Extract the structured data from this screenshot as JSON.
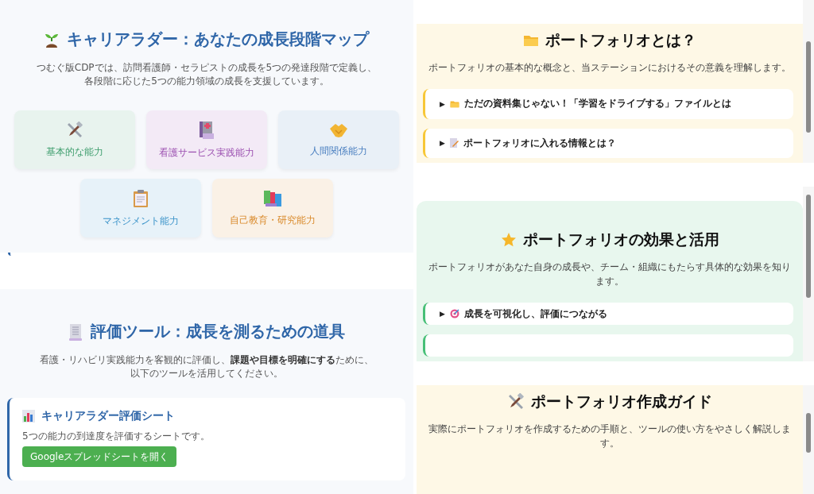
{
  "career_ladder": {
    "title": "キャリアラダー：あなたの成長段階マップ",
    "description": [
      "つむぐ版CDPでは、訪問看護師・セラピストの成長を5つの発達段階で定義し、",
      "各段階に応じた5つの能力領域の成長を支援しています。"
    ],
    "abilities": [
      {
        "label": "基本的な能力",
        "color": "#3f9e6e"
      },
      {
        "label": "看護サービス実践能力",
        "color": "#9b4fb0"
      },
      {
        "label": "人間関係能力",
        "color": "#4a7fc0"
      },
      {
        "label": "マネジメント能力",
        "color": "#3a93c9"
      },
      {
        "label": "自己教育・研究能力",
        "color": "#d98a2b"
      }
    ]
  },
  "evaluation_tools": {
    "title": "評価ツール：成長を測るための道具",
    "description": [
      "看護・リハビリ実践能力を客観的に評価し、**課題や目標を明確にする**ために、",
      "以下のツールを活用してください。"
    ],
    "tools": [
      {
        "title": "キャリアラダー評価シート",
        "description": "5つの能力の到達度を評価するシートです。",
        "button": "Googleスプレッドシートを開く"
      }
    ]
  },
  "portfolio_panels": [
    {
      "title": "ポートフォリオとは？",
      "description": "ポートフォリオの基本的な概念と、当ステーションにおけるその意義を理解します。",
      "color": "#fef8e6",
      "accordions": [
        {
          "marker": "▶",
          "label": "ただの資料集じゃない！「学習をドライブする」ファイルとは"
        },
        {
          "marker": "▶",
          "label": "ポートフォリオに入れる情報とは？"
        }
      ]
    },
    {
      "title": "ポートフォリオの効果と活用",
      "description": "ポートフォリオがあなた自身の成長や、チーム・組織にもたらす具体的な効果を知ります。",
      "color": "#e8f7ee",
      "accordions": [
        {
          "marker": "▶",
          "label": "成長を可視化し、評価につながる"
        }
      ]
    },
    {
      "title": "ポートフォリオ作成ガイド",
      "description": "実際にポートフォリオを作成するための手順と、ツールの使い方をやさしく解説します。",
      "color": "#fef8e6"
    }
  ]
}
